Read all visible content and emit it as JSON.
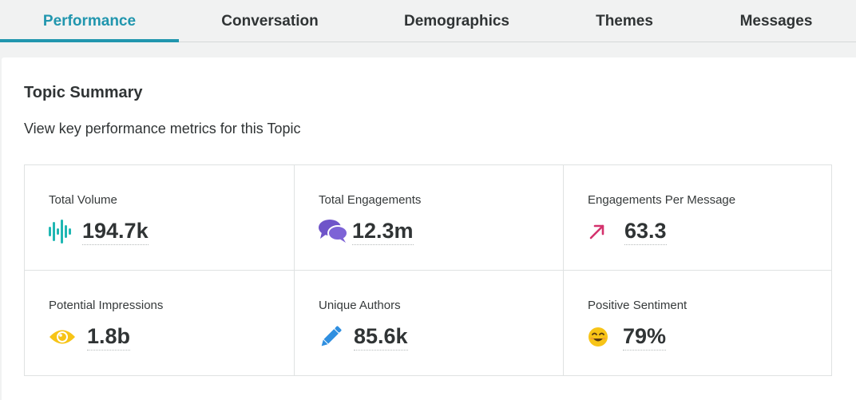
{
  "tabs": [
    {
      "label": "Performance",
      "active": true
    },
    {
      "label": "Conversation",
      "active": false
    },
    {
      "label": "Demographics",
      "active": false
    },
    {
      "label": "Themes",
      "active": false
    },
    {
      "label": "Messages",
      "active": false
    }
  ],
  "summary": {
    "title": "Topic Summary",
    "subtitle": "View key performance metrics for this Topic"
  },
  "metrics": [
    {
      "label": "Total Volume",
      "value": "194.7k",
      "icon": "volume-bars-icon",
      "color": "#1fb7b3"
    },
    {
      "label": "Total Engagements",
      "value": "12.3m",
      "icon": "chat-bubbles-icon",
      "color": "#6f54c9"
    },
    {
      "label": "Engagements Per Message",
      "value": "63.3",
      "icon": "arrow-up-right-icon",
      "color": "#d4326d"
    },
    {
      "label": "Potential Impressions",
      "value": "1.8b",
      "icon": "eye-icon",
      "color": "#f7c417"
    },
    {
      "label": "Unique Authors",
      "value": "85.6k",
      "icon": "pencil-icon",
      "color": "#2f8fe0"
    },
    {
      "label": "Positive Sentiment",
      "value": "79%",
      "icon": "smiley-icon",
      "color": "#f7c417"
    }
  ],
  "colors": {
    "accent": "#2196ae",
    "text": "#303435",
    "background": "#f1f2f2",
    "panel": "#ffffff",
    "border": "#dfe2e2"
  }
}
